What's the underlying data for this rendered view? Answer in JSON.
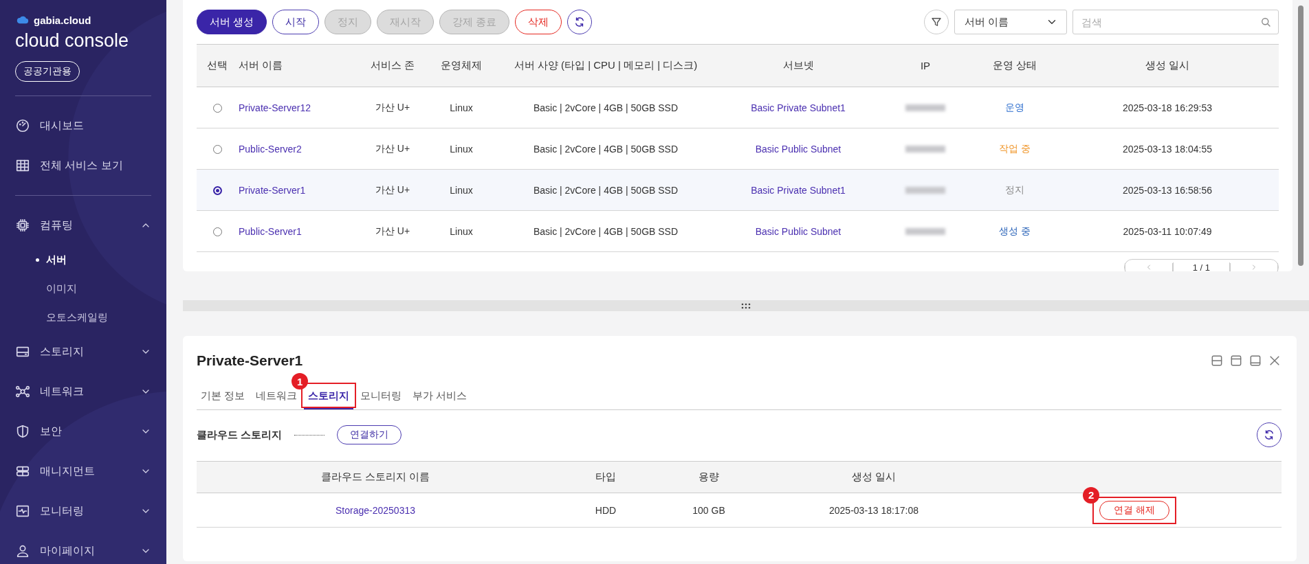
{
  "sidebar": {
    "logo": "gabia.cloud",
    "title": "cloud console",
    "badge": "공공기관용",
    "links": [
      {
        "label": "대시보드"
      },
      {
        "label": "전체 서비스 보기"
      }
    ],
    "menu": [
      {
        "label": "컴퓨팅",
        "expanded": true,
        "children": [
          {
            "label": "서버",
            "selected": true
          },
          {
            "label": "이미지",
            "selected": false
          },
          {
            "label": "오토스케일링",
            "selected": false
          }
        ]
      },
      {
        "label": "스토리지",
        "expanded": false
      },
      {
        "label": "네트워크",
        "expanded": false
      },
      {
        "label": "보안",
        "expanded": false
      },
      {
        "label": "매니지먼트",
        "expanded": false
      },
      {
        "label": "모니터링",
        "expanded": false
      },
      {
        "label": "마이페이지",
        "expanded": false
      }
    ]
  },
  "toolbar": {
    "buttons": [
      {
        "label": "서버 생성",
        "kind": "primary",
        "disabled": false
      },
      {
        "label": "시작",
        "kind": "outline",
        "disabled": false
      },
      {
        "label": "정지",
        "kind": "outline",
        "disabled": true
      },
      {
        "label": "재시작",
        "kind": "outline",
        "disabled": true
      },
      {
        "label": "강제 종료",
        "kind": "outline",
        "disabled": true
      },
      {
        "label": "삭제",
        "kind": "danger",
        "disabled": false
      }
    ],
    "filter_select": "서버 이름",
    "search": {
      "placeholder": "검색"
    }
  },
  "server_table": {
    "columns": [
      "선택",
      "서버 이름",
      "서비스 존",
      "운영체제",
      "서버 사양 (타입 | CPU | 메모리 | 디스크)",
      "서브넷",
      "IP",
      "운영 상태",
      "생성 일시"
    ],
    "rows": [
      {
        "selected": false,
        "name": "Private-Server12",
        "zone": "가산 U+",
        "os": "Linux",
        "spec": "Basic | 2vCore | 4GB | 50GB SSD",
        "subnet": "Basic Private Subnet1",
        "status": "운영",
        "color": "#2f6fce",
        "created": "2025-03-18 16:29:53"
      },
      {
        "selected": false,
        "name": "Public-Server2",
        "zone": "가산 U+",
        "os": "Linux",
        "spec": "Basic | 2vCore | 4GB | 50GB SSD",
        "subnet": "Basic Public Subnet",
        "status": "작업 중",
        "color": "#f0962a",
        "created": "2025-03-13 18:04:55"
      },
      {
        "selected": true,
        "name": "Private-Server1",
        "zone": "가산 U+",
        "os": "Linux",
        "spec": "Basic | 2vCore | 4GB | 50GB SSD",
        "subnet": "Basic Private Subnet1",
        "status": "정지",
        "color": "#8a8a8a",
        "created": "2025-03-13 16:58:56"
      },
      {
        "selected": false,
        "name": "Public-Server1",
        "zone": "가산 U+",
        "os": "Linux",
        "spec": "Basic | 2vCore | 4GB | 50GB SSD",
        "subnet": "Basic Public Subnet",
        "status": "생성 중",
        "color": "#2a63b8",
        "created": "2025-03-11 10:07:49"
      }
    ],
    "pagination": "1 / 1"
  },
  "detail": {
    "title": "Private-Server1",
    "tabs": [
      {
        "label": "기본 정보",
        "selected": false
      },
      {
        "label": "네트워크",
        "selected": false
      },
      {
        "label": "스토리지",
        "selected": true,
        "annotation": "1"
      },
      {
        "label": "모니터링",
        "selected": false
      },
      {
        "label": "부가 서비스",
        "selected": false
      }
    ],
    "section": {
      "label": "클라우드 스토리지",
      "connect_button": "연결하기"
    },
    "storage_table": {
      "columns": [
        "클라우드 스토리지 이름",
        "타입",
        "용량",
        "생성 일시"
      ],
      "rows": [
        {
          "name": "Storage-20250313",
          "type": "HDD",
          "size": "100 GB",
          "created": "2025-03-13 18:17:08",
          "action": "연결 해제",
          "annotation": "2"
        }
      ]
    }
  }
}
